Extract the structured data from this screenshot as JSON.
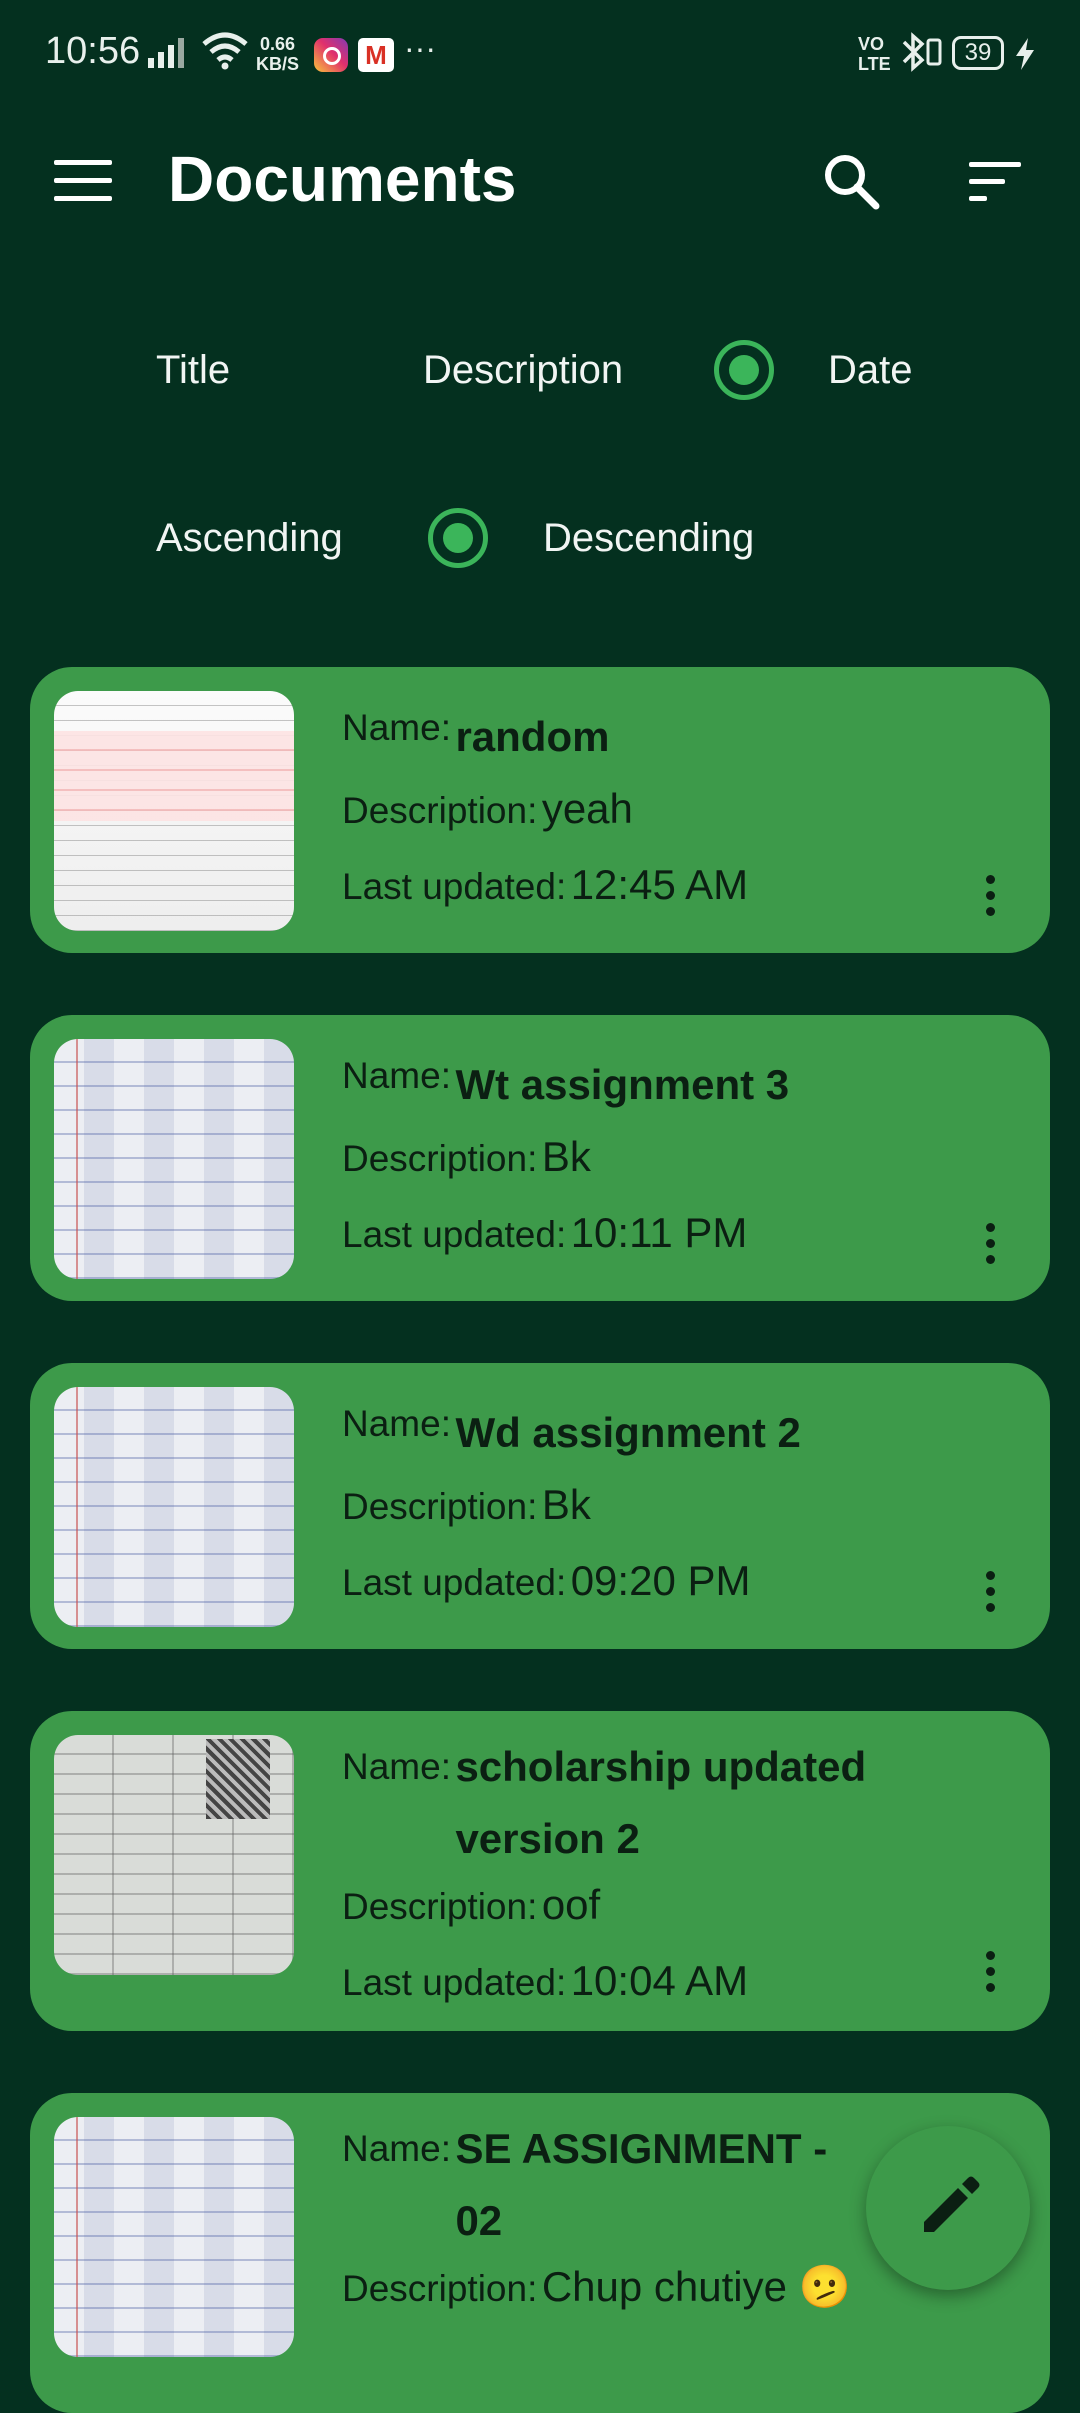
{
  "status_bar": {
    "time": "10:56",
    "net_speed_value": "0.66",
    "net_speed_unit": "KB/S",
    "volte_top": "VO",
    "volte_bottom": "LTE",
    "battery": "39",
    "more": "···",
    "gmail_letter": "M"
  },
  "app_bar": {
    "title": "Documents"
  },
  "sort_by": {
    "options": [
      "Title",
      "Description",
      "Date"
    ],
    "selected": "Date"
  },
  "order": {
    "options": [
      "Ascending",
      "Descending"
    ],
    "selected": "Descending"
  },
  "labels": {
    "name": "Name:",
    "description": "Description:",
    "last_updated": "Last updated:"
  },
  "documents": [
    {
      "name": "random",
      "description": "yeah",
      "last_updated": "12:45 AM"
    },
    {
      "name": "Wt assignment 3",
      "description": "Bk",
      "last_updated": "10:11 PM"
    },
    {
      "name": "Wd assignment 2",
      "description": "Bk",
      "last_updated": "09:20 PM"
    },
    {
      "name": "scholarship updated version 2",
      "description": "oof",
      "last_updated": "10:04 AM"
    },
    {
      "name": "SE ASSIGNMENT - 02",
      "description": "Chup chutiye 🫤",
      "last_updated": ""
    }
  ],
  "colors": {
    "background": "#04301f",
    "card": "#3d9a4a",
    "accent": "#3bb55a"
  },
  "icons": {
    "menu": "hamburger-menu-icon",
    "search": "search-icon",
    "sort": "sort-icon",
    "more": "more-vert-icon",
    "fab": "pencil-icon"
  }
}
